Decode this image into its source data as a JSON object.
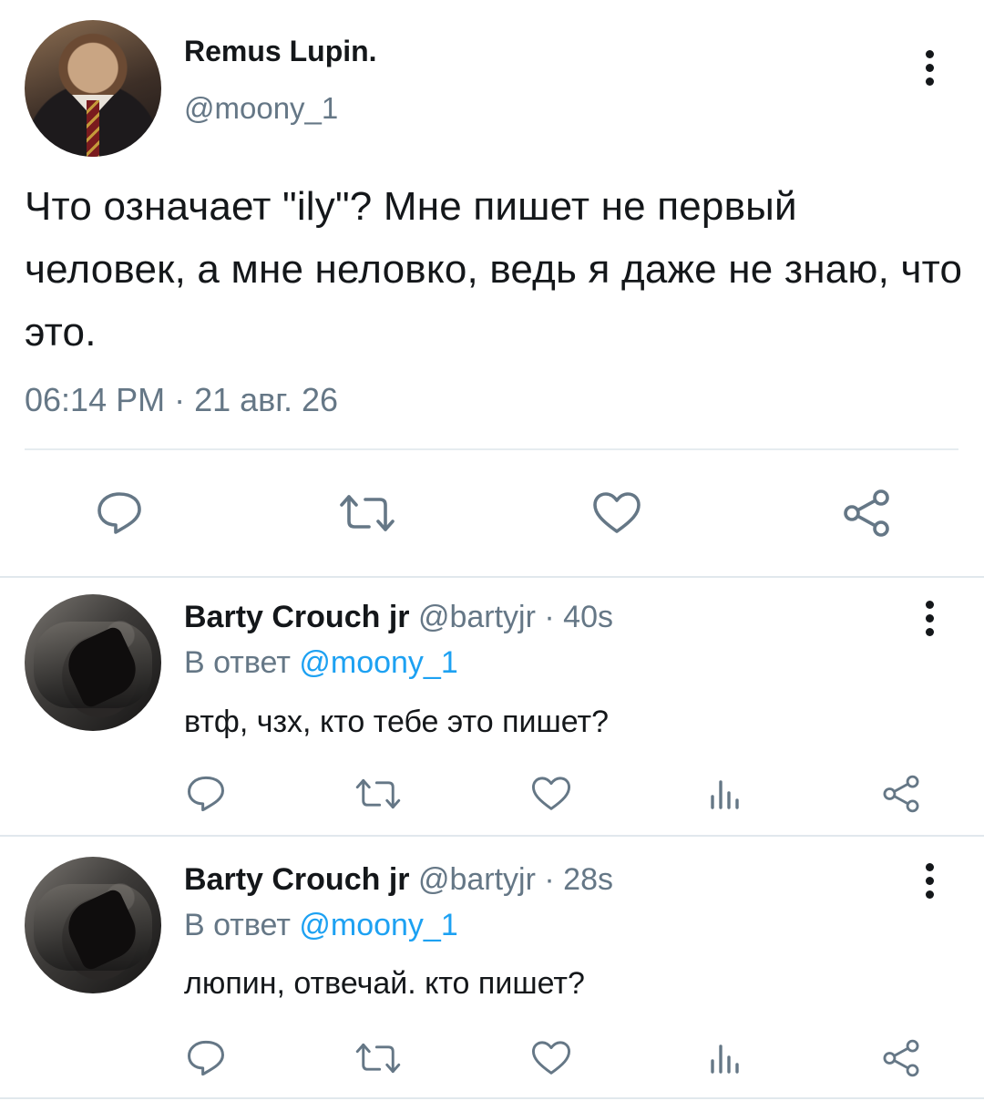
{
  "main_tweet": {
    "author_name": "Remus Lupin.",
    "author_handle": "@moony_1",
    "text": "Что означает \"ily\"? Мне пишет не первый человек, а мне неловко, ведь я даже не знаю, что это.",
    "timestamp": "06:14 PM · 21 авг. 26",
    "actions": [
      "reply-icon",
      "retweet-icon",
      "like-icon",
      "share-icon"
    ]
  },
  "replies": [
    {
      "author_name": "Barty Crouch jr",
      "author_handle": "@bartyjr",
      "time": "· 40s",
      "reply_prefix": "В ответ",
      "reply_to": "@moony_1",
      "text": "втф, чзх, кто тебе это пишет?",
      "actions": [
        "reply-icon",
        "retweet-icon",
        "like-icon",
        "analytics-icon",
        "share-icon"
      ]
    },
    {
      "author_name": "Barty Crouch jr",
      "author_handle": "@bartyjr",
      "time": "· 28s",
      "reply_prefix": "В ответ",
      "reply_to": "@moony_1",
      "text": "люпин, отвечай. кто пишет?",
      "actions": [
        "reply-icon",
        "retweet-icon",
        "like-icon",
        "analytics-icon",
        "share-icon"
      ]
    }
  ],
  "colors": {
    "text": "#14171a",
    "secondary": "#657786",
    "accent": "#1da1f2",
    "divider": "#e6ecf0"
  }
}
